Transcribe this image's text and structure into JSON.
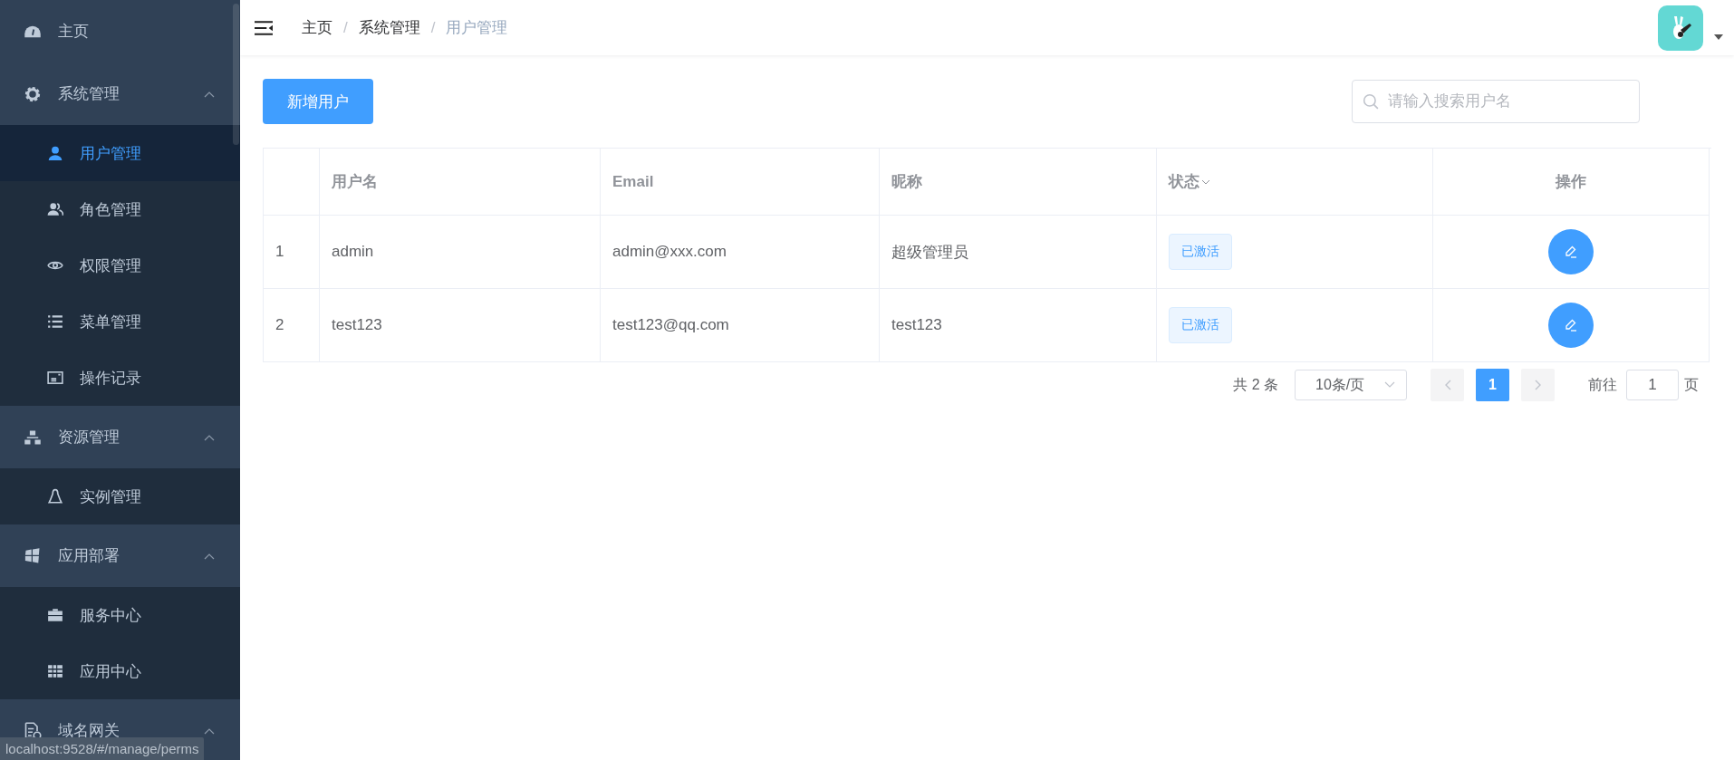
{
  "sidebar": {
    "items": [
      {
        "label": "主页",
        "selected": false
      },
      {
        "label": "系统管理",
        "expanded": true,
        "selected": false,
        "children": [
          {
            "label": "用户管理",
            "selected": true
          },
          {
            "label": "角色管理",
            "selected": false
          },
          {
            "label": "权限管理",
            "selected": false
          },
          {
            "label": "菜单管理",
            "selected": false
          },
          {
            "label": "操作记录",
            "selected": false
          }
        ]
      },
      {
        "label": "资源管理",
        "expanded": true,
        "selected": false,
        "children": [
          {
            "label": "实例管理",
            "selected": false
          }
        ]
      },
      {
        "label": "应用部署",
        "expanded": true,
        "selected": false,
        "children": [
          {
            "label": "服务中心",
            "selected": false
          },
          {
            "label": "应用中心",
            "selected": false
          }
        ]
      },
      {
        "label": "域名网关",
        "expanded": true,
        "selected": false
      }
    ]
  },
  "breadcrumb": [
    {
      "label": "主页",
      "current": false
    },
    {
      "separator": "/",
      "label": "系统管理",
      "current": false
    },
    {
      "separator": "/",
      "label": "用户管理",
      "current": true
    }
  ],
  "toolbar": {
    "add_button": "新增用户",
    "search": {
      "placeholder": "请输入搜索用户名"
    }
  },
  "table": {
    "columns": [
      {
        "label": "用户名",
        "sortable": false
      },
      {
        "label": "Email",
        "sortable": false
      },
      {
        "label": "昵称",
        "sortable": false
      },
      {
        "label": "状态",
        "sortable": true
      },
      {
        "label": "操作",
        "sortable": false
      }
    ],
    "rows": [
      {
        "index": "1",
        "username": "admin",
        "email": "admin@xxx.com",
        "nickname": "超级管理员",
        "status": "已激活"
      },
      {
        "index": "2",
        "username": "test123",
        "email": "test123@qq.com",
        "nickname": "test123",
        "status": "已激活"
      }
    ]
  },
  "pagination": {
    "total": "共 2 条",
    "page_size": "10条/页",
    "pages": [
      {
        "label": "1",
        "selected": true
      }
    ],
    "prev_disabled": true,
    "next_disabled": true,
    "goto_label": "前往",
    "goto_value": "1",
    "goto_suffix": "页"
  },
  "status_url": "localhost:9528/#/manage/perms"
}
